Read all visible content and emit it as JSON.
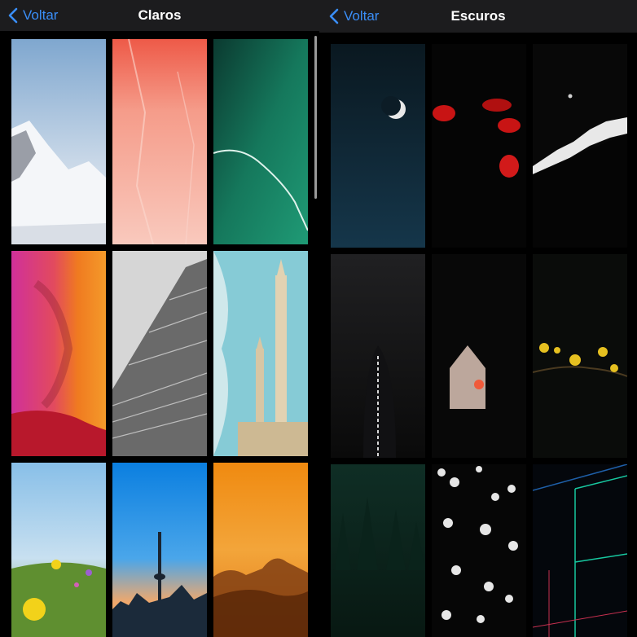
{
  "left_panel": {
    "back_label": "Voltar",
    "title": "Claros",
    "wallpapers": [
      {
        "name": "snowy-mountain",
        "colors": [
          "#8fb4d6",
          "#e9eef5"
        ]
      },
      {
        "name": "pink-marble",
        "colors": [
          "#f06a52",
          "#f7c2b5"
        ]
      },
      {
        "name": "green-water",
        "colors": [
          "#0d4b3c",
          "#1c8f6c"
        ]
      },
      {
        "name": "colorful-fabrics",
        "colors": [
          "#c02a90",
          "#f08a20"
        ]
      },
      {
        "name": "stone-pyramid",
        "colors": [
          "#cfcfcf",
          "#555555"
        ]
      },
      {
        "name": "mosque-towers",
        "colors": [
          "#7fc8d4",
          "#d8c3a0"
        ]
      },
      {
        "name": "wildflower-meadow",
        "colors": [
          "#8fc3ea",
          "#6aa03a"
        ]
      },
      {
        "name": "city-tv-tower",
        "colors": [
          "#1f8ee0",
          "#f0a060"
        ]
      },
      {
        "name": "orange-sunset-hills",
        "colors": [
          "#f09a22",
          "#7a3a10"
        ]
      }
    ]
  },
  "right_panel": {
    "back_label": "Voltar",
    "title": "Escuros",
    "wallpapers": [
      {
        "name": "crescent-moon",
        "colors": [
          "#0b1a22",
          "#12303d"
        ]
      },
      {
        "name": "red-jellyfish",
        "colors": [
          "#050505",
          "#cc1515"
        ]
      },
      {
        "name": "dark-mountain",
        "colors": [
          "#0a0a0a",
          "#e8e8e8"
        ]
      },
      {
        "name": "dark-tower",
        "colors": [
          "#1e1e20",
          "#050505"
        ]
      },
      {
        "name": "arch-sunset",
        "colors": [
          "#0a0a0a",
          "#f06040"
        ]
      },
      {
        "name": "yellow-blossoms",
        "colors": [
          "#0a0c0a",
          "#e6c020"
        ]
      },
      {
        "name": "dark-forest",
        "colors": [
          "#0e2a22",
          "#071510"
        ]
      },
      {
        "name": "white-flowers",
        "colors": [
          "#060606",
          "#e6e6e6"
        ]
      },
      {
        "name": "neon-grid-room",
        "colors": [
          "#040810",
          "#17c8a0"
        ]
      }
    ]
  }
}
